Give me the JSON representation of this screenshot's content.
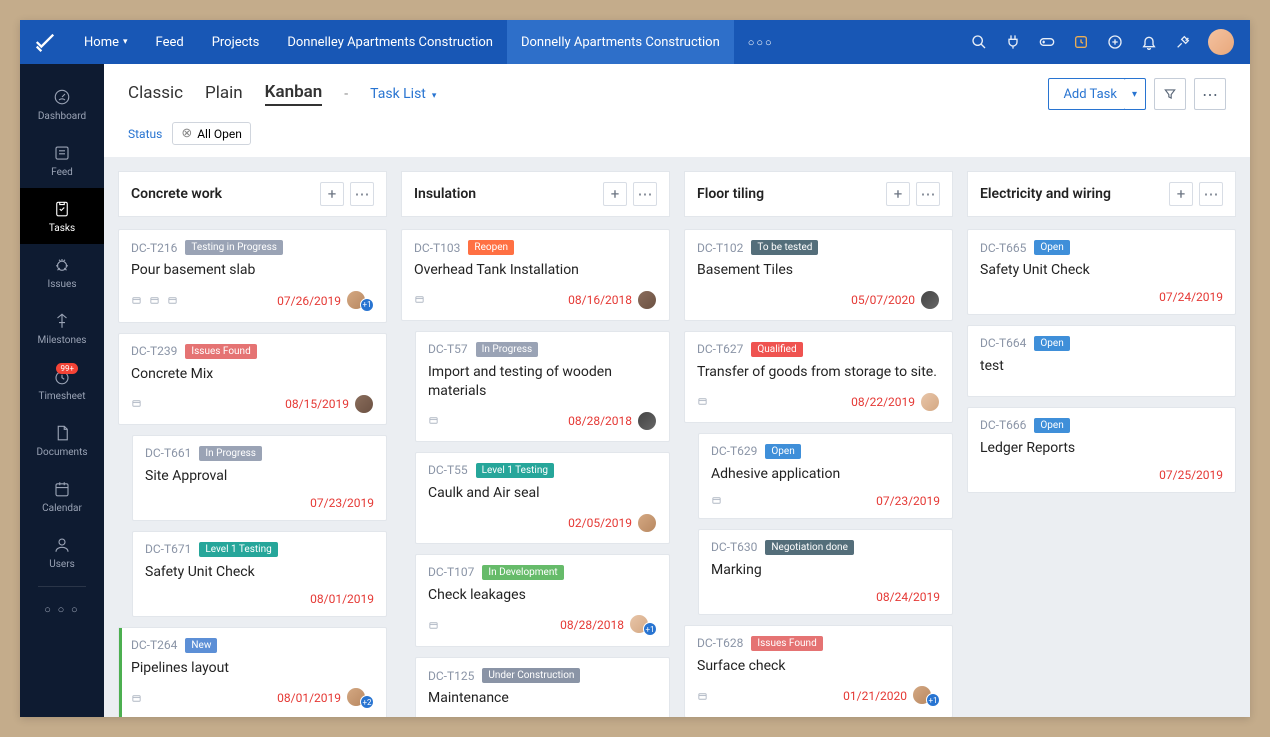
{
  "topnav": {
    "home": "Home",
    "feed": "Feed",
    "projects": "Projects",
    "crumb1": "Donnelley Apartments Construction",
    "crumb2": "Donnelly Apartments Construction"
  },
  "sidebar": {
    "dashboard": "Dashboard",
    "feed": "Feed",
    "tasks": "Tasks",
    "issues": "Issues",
    "milestones": "Milestones",
    "timesheet": "Timesheet",
    "timesheet_badge": "99+",
    "documents": "Documents",
    "calendar": "Calendar",
    "users": "Users"
  },
  "views": {
    "classic": "Classic",
    "plain": "Plain",
    "kanban": "Kanban",
    "sep": "-",
    "tasklist": "Task List",
    "addtask": "Add Task"
  },
  "filter": {
    "label": "Status",
    "chip": "All Open"
  },
  "badges": {
    "testing_progress": "Testing in Progress",
    "issues_found": "Issues Found",
    "in_progress": "In Progress",
    "level1": "Level 1 Testing",
    "new": "New",
    "reopen": "Reopen",
    "in_dev": "In Development",
    "under_const": "Under Construction",
    "tobetested": "To be tested",
    "qualified": "Qualified",
    "open": "Open",
    "negotiation": "Negotiation done"
  },
  "columns": [
    {
      "title": "Concrete work",
      "cards": [
        {
          "id": "DC-T216",
          "badge": "testing_progress",
          "bcolor": "#9aa3b5",
          "title": "Pour basement slab",
          "date": "07/26/2019",
          "icons": 3,
          "av": [
            "a1"
          ],
          "plus": "+1"
        },
        {
          "id": "DC-T239",
          "badge": "issues_found",
          "bcolor": "#e57373",
          "title": "Concrete Mix",
          "date": "08/15/2019",
          "icons": 1,
          "av": [
            "a2"
          ]
        },
        {
          "id": "DC-T661",
          "badge": "in_progress",
          "bcolor": "#9aa3b5",
          "title": "Site Approval",
          "date": "07/23/2019",
          "indent": true
        },
        {
          "id": "DC-T671",
          "badge": "level1",
          "bcolor": "#26a69a",
          "title": "Safety Unit Check",
          "date": "08/01/2019",
          "indent": true
        },
        {
          "id": "DC-T264",
          "badge": "new",
          "bcolor": "#5c8fd6",
          "title": "Pipelines layout",
          "date": "08/01/2019",
          "icons": 1,
          "av": [
            "a1"
          ],
          "plus": "+2",
          "stripe": true
        }
      ]
    },
    {
      "title": "Insulation",
      "cards": [
        {
          "id": "DC-T103",
          "badge": "reopen",
          "bcolor": "#ff7043",
          "title": "Overhead Tank Installation",
          "date": "08/16/2018",
          "icons": 1,
          "av": [
            "a2"
          ]
        },
        {
          "id": "DC-T57",
          "badge": "in_progress",
          "bcolor": "#9aa3b5",
          "title": "Import and testing of wooden materials",
          "date": "08/28/2018",
          "icons": 1,
          "av": [
            "a4"
          ],
          "indent": true
        },
        {
          "id": "DC-T55",
          "badge": "level1",
          "bcolor": "#26a69a",
          "title": "Caulk and Air seal",
          "date": "02/05/2019",
          "av": [
            "a1"
          ],
          "indent": true
        },
        {
          "id": "DC-T107",
          "badge": "in_dev",
          "bcolor": "#66bb6a",
          "title": "Check leakages",
          "date": "08/28/2018",
          "icons": 1,
          "av": [
            "a3"
          ],
          "plus": "+1",
          "indent": true
        },
        {
          "id": "DC-T125",
          "badge": "under_const",
          "bcolor": "#8a94a6",
          "title": "Maintenance",
          "indent": true
        }
      ]
    },
    {
      "title": "Floor tiling",
      "cards": [
        {
          "id": "DC-T102",
          "badge": "tobetested",
          "bcolor": "#546e7a",
          "title": "Basement Tiles",
          "date": "05/07/2020",
          "av": [
            "a4"
          ]
        },
        {
          "id": "DC-T627",
          "badge": "qualified",
          "bcolor": "#ef5350",
          "title": "Transfer of goods from storage to site.",
          "date": "08/22/2019",
          "icons": 1,
          "av": [
            "a3"
          ]
        },
        {
          "id": "DC-T629",
          "badge": "open",
          "bcolor": "#3f8fd9",
          "title": "Adhesive application",
          "date": "07/23/2019",
          "icons": 1,
          "indent": true
        },
        {
          "id": "DC-T630",
          "badge": "negotiation",
          "bcolor": "#546e7a",
          "title": "Marking",
          "date": "08/24/2019",
          "indent": true
        },
        {
          "id": "DC-T628",
          "badge": "issues_found",
          "bcolor": "#e57373",
          "title": "Surface check",
          "date": "01/21/2020",
          "icons": 1,
          "av": [
            "a1"
          ],
          "plus": "+1"
        }
      ]
    },
    {
      "title": "Electricity and wiring",
      "cards": [
        {
          "id": "DC-T665",
          "badge": "open",
          "bcolor": "#3f8fd9",
          "title": "Safety Unit Check",
          "date": "07/24/2019"
        },
        {
          "id": "DC-T664",
          "badge": "open",
          "bcolor": "#3f8fd9",
          "title": "test"
        },
        {
          "id": "DC-T666",
          "badge": "open",
          "bcolor": "#3f8fd9",
          "title": "Ledger Reports",
          "date": "07/25/2019"
        }
      ]
    }
  ]
}
